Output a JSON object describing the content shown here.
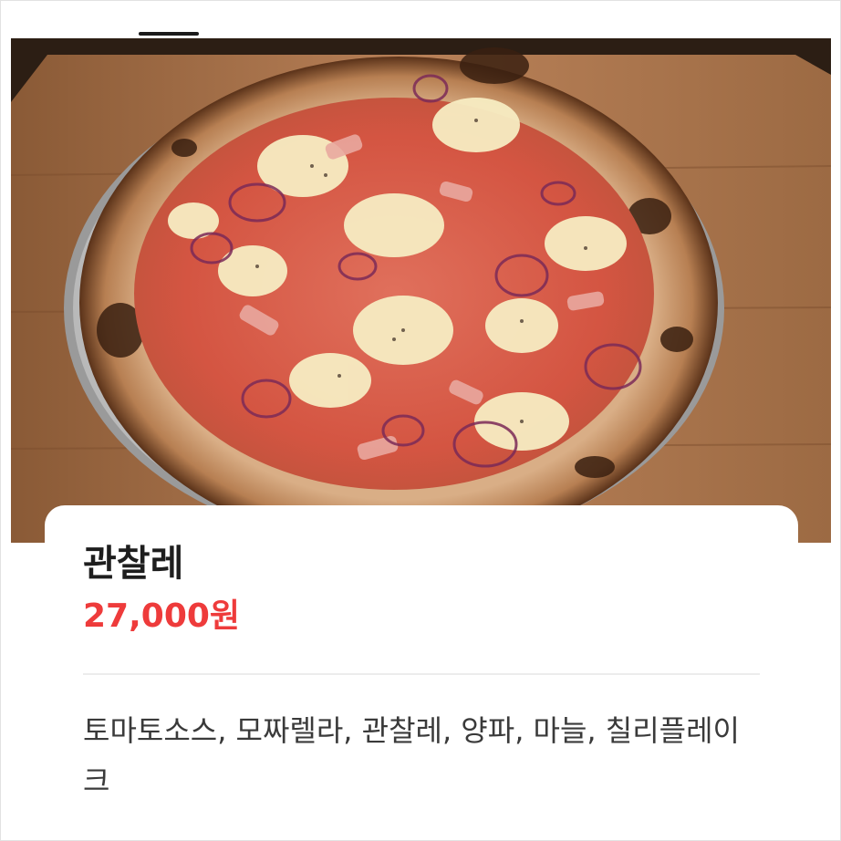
{
  "menu": {
    "name": "관찰레",
    "price": "27,000원",
    "description": "토마토소스, 모짜렐라, 관찰레, 양파, 마늘, 칠리플레이크"
  },
  "photo": {
    "subject": "pizza-photo"
  },
  "colors": {
    "price": "#ee3b3b",
    "title": "#1e1e1e",
    "description": "#3a3a3a",
    "divider": "#ececec"
  }
}
